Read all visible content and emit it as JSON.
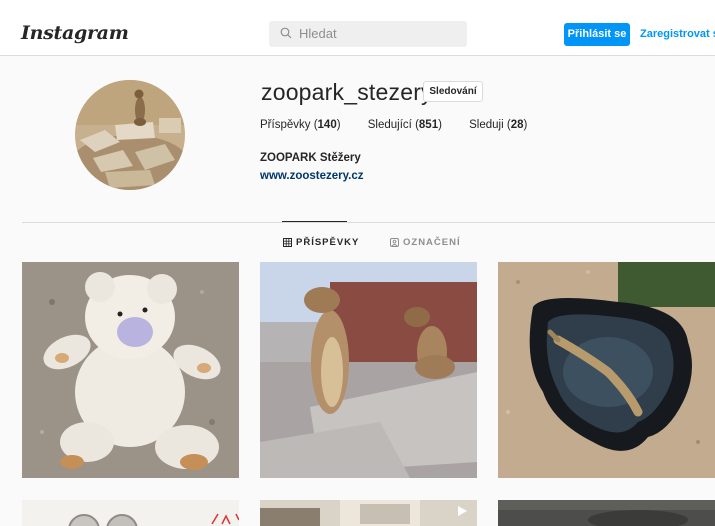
{
  "header": {
    "logo": "Instagram",
    "search_placeholder": "Hledat",
    "login_label": "Přihlásit se",
    "register_label": "Zaregistrovat se",
    "brand_color": "#0095f6"
  },
  "profile": {
    "username": "zoopark_stezery",
    "follow_label": "Sledování",
    "stats": [
      {
        "label": "Příspěvky",
        "count": "140"
      },
      {
        "label": "Sledující",
        "count": "851"
      },
      {
        "label": "Sleduji",
        "count": "28"
      }
    ],
    "full_name": "ZOOPARK Stěžery",
    "website": "www.zoostezery.cz"
  },
  "tabs": [
    {
      "label": "PŘÍSPĚVKY",
      "icon": "grid-icon",
      "active": true
    },
    {
      "label": "OZNAČENÍ",
      "icon": "tagged-icon",
      "active": false
    }
  ],
  "posts": [
    {
      "subject": "teddy-bear"
    },
    {
      "subject": "meerkats"
    },
    {
      "subject": "crocodile-pond"
    },
    {
      "subject": "coins"
    },
    {
      "subject": "video-room"
    },
    {
      "subject": "dark-photo"
    }
  ]
}
